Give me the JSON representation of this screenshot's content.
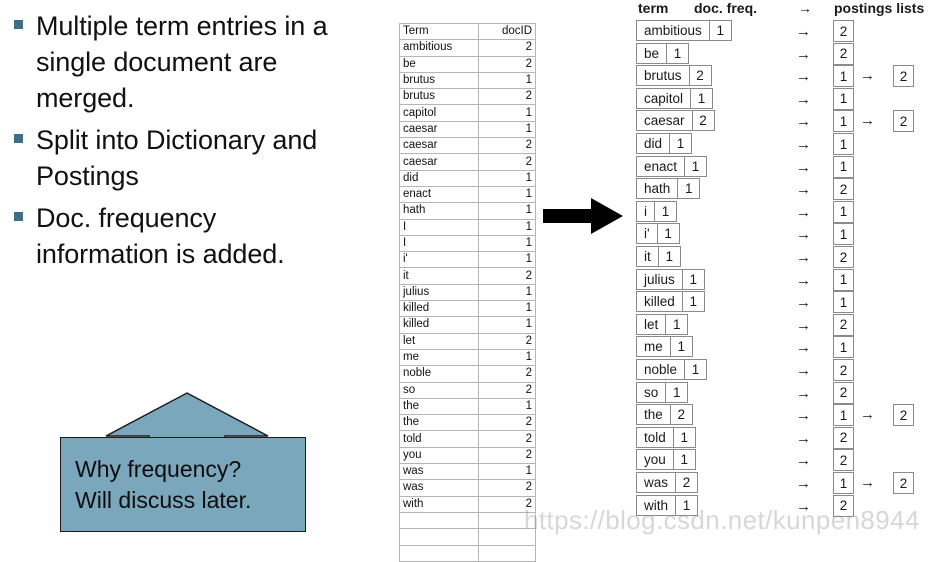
{
  "slide": {
    "bullets": [
      "Multiple term entries in a single document are merged.",
      "Split into Dictionary and Postings",
      "Doc. frequency information is added."
    ],
    "callout": {
      "line1": "Why frequency?",
      "line2": "Will discuss later.",
      "fill_color": "#7ba7bd",
      "bullet_color": "#3f6e85"
    },
    "transform_arrow": "right-arrow"
  },
  "term_table": {
    "headers": [
      "Term",
      "docID"
    ],
    "rows": [
      [
        "ambitious",
        "2"
      ],
      [
        "be",
        "2"
      ],
      [
        "brutus",
        "1"
      ],
      [
        "brutus",
        "2"
      ],
      [
        "capitol",
        "1"
      ],
      [
        "caesar",
        "1"
      ],
      [
        "caesar",
        "2"
      ],
      [
        "caesar",
        "2"
      ],
      [
        "did",
        "1"
      ],
      [
        "enact",
        "1"
      ],
      [
        "hath",
        "1"
      ],
      [
        "I",
        "1"
      ],
      [
        "I",
        "1"
      ],
      [
        "i'",
        "1"
      ],
      [
        "it",
        "2"
      ],
      [
        "julius",
        "1"
      ],
      [
        "killed",
        "1"
      ],
      [
        "killed",
        "1"
      ],
      [
        "let",
        "2"
      ],
      [
        "me",
        "1"
      ],
      [
        "noble",
        "2"
      ],
      [
        "so",
        "2"
      ],
      [
        "the",
        "1"
      ],
      [
        "the",
        "2"
      ],
      [
        "told",
        "2"
      ],
      [
        "you",
        "2"
      ],
      [
        "was",
        "1"
      ],
      [
        "was",
        "2"
      ],
      [
        "with",
        "2"
      ],
      [
        "",
        ""
      ],
      [
        "",
        ""
      ],
      [
        "",
        ""
      ]
    ]
  },
  "dictionary": {
    "headers": {
      "term": "term",
      "doc_freq": "doc. freq.",
      "arrow": "→",
      "postings": "postings lists"
    },
    "row_arrow": "→",
    "postings_arrow": "→",
    "entries": [
      {
        "term": "ambitious",
        "freq": "1",
        "postings": [
          "2"
        ]
      },
      {
        "term": "be",
        "freq": "1",
        "postings": [
          "2"
        ]
      },
      {
        "term": "brutus",
        "freq": "2",
        "postings": [
          "1",
          "2"
        ]
      },
      {
        "term": "capitol",
        "freq": "1",
        "postings": [
          "1"
        ]
      },
      {
        "term": "caesar",
        "freq": "2",
        "postings": [
          "1",
          "2"
        ]
      },
      {
        "term": "did",
        "freq": "1",
        "postings": [
          "1"
        ]
      },
      {
        "term": "enact",
        "freq": "1",
        "postings": [
          "1"
        ]
      },
      {
        "term": "hath",
        "freq": "1",
        "postings": [
          "2"
        ]
      },
      {
        "term": "i",
        "freq": "1",
        "postings": [
          "1"
        ]
      },
      {
        "term": "i'",
        "freq": "1",
        "postings": [
          "1"
        ]
      },
      {
        "term": "it",
        "freq": "1",
        "postings": [
          "2"
        ]
      },
      {
        "term": "julius",
        "freq": "1",
        "postings": [
          "1"
        ]
      },
      {
        "term": "killed",
        "freq": "1",
        "postings": [
          "1"
        ]
      },
      {
        "term": "let",
        "freq": "1",
        "postings": [
          "2"
        ]
      },
      {
        "term": "me",
        "freq": "1",
        "postings": [
          "1"
        ]
      },
      {
        "term": "noble",
        "freq": "1",
        "postings": [
          "2"
        ]
      },
      {
        "term": "so",
        "freq": "1",
        "postings": [
          "2"
        ]
      },
      {
        "term": "the",
        "freq": "2",
        "postings": [
          "1",
          "2"
        ]
      },
      {
        "term": "told",
        "freq": "1",
        "postings": [
          "2"
        ]
      },
      {
        "term": "you",
        "freq": "1",
        "postings": [
          "2"
        ]
      },
      {
        "term": "was",
        "freq": "2",
        "postings": [
          "1",
          "2"
        ]
      },
      {
        "term": "with",
        "freq": "1",
        "postings": [
          "2"
        ]
      }
    ]
  },
  "watermark": "https://blog.csdn.net/kunpen8944"
}
